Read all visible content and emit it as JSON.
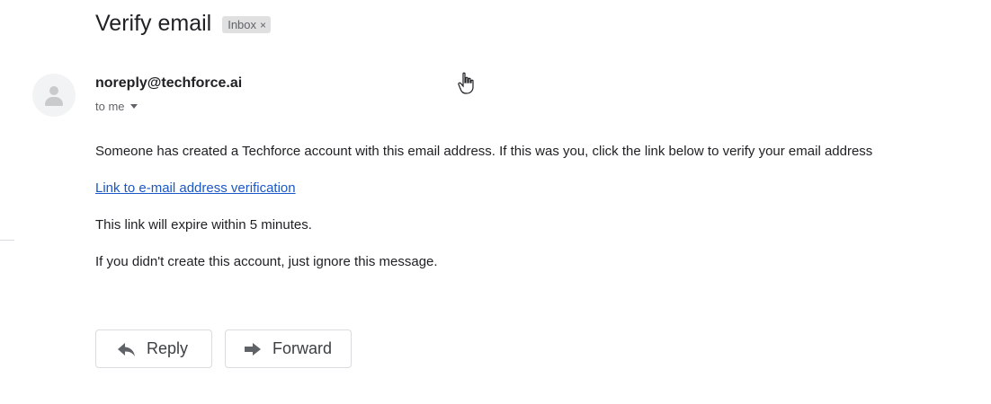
{
  "email": {
    "subject": "Verify email",
    "label": "Inbox",
    "label_remove": "×",
    "sender": "noreply@techforce.ai",
    "recipient": "to me",
    "body": {
      "paragraph1": "Someone has created a Techforce account with this email address. If this was you, click the link below to verify your email address",
      "link": "Link to e-mail address verification",
      "paragraph2": "This link will expire within 5 minutes.",
      "paragraph3": "If you didn't create this account, just ignore this message."
    }
  },
  "actions": {
    "reply_label": "Reply",
    "forward_label": "Forward"
  },
  "icons": {
    "avatar": "person-icon",
    "reply": "reply-arrow-icon",
    "forward": "forward-arrow-icon",
    "cursor": "hand-cursor-icon"
  },
  "colors": {
    "link": "#1a57c8",
    "chip_bg": "#e0e0e0",
    "text": "#202124"
  }
}
